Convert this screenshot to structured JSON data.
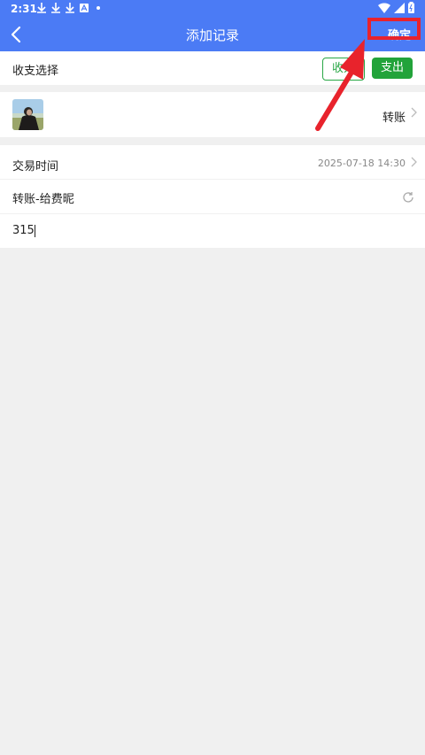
{
  "status_bar": {
    "time": "2:31",
    "icons": [
      "download-icon",
      "download-icon",
      "download-icon",
      "a-icon",
      "dot-icon"
    ],
    "right_icons": [
      "wifi-icon",
      "signal-icon",
      "battery-icon"
    ]
  },
  "appbar": {
    "title": "添加记录",
    "confirm_label": "确定",
    "color": "#4b7bf5"
  },
  "income_expense": {
    "label": "收支选择",
    "income_label": "收入",
    "expense_label": "支出",
    "selected": "expense"
  },
  "category": {
    "label": "转账"
  },
  "form": {
    "time_label": "交易时间",
    "time_value": "2025-07-18 14:30",
    "note_value": "转账-给费昵",
    "amount_value": "315"
  },
  "annotation": {
    "color": "#e8232c"
  }
}
